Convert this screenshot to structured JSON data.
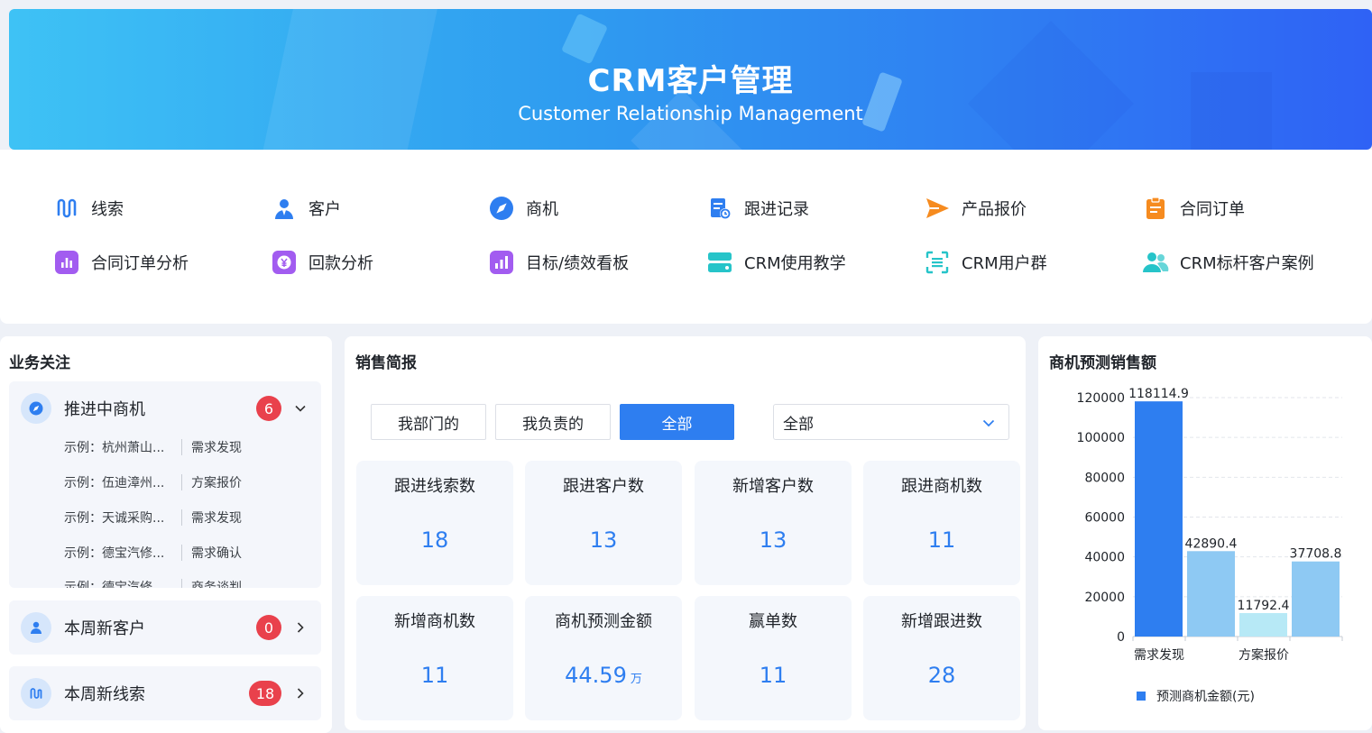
{
  "banner": {
    "title": "CRM客户管理",
    "subtitle": "Customer Relationship Management"
  },
  "quick_nav": [
    {
      "label": "线索",
      "icon": "clue-icon",
      "color": "#2e7ef0"
    },
    {
      "label": "客户",
      "icon": "user-icon",
      "color": "#2e7ef0"
    },
    {
      "label": "商机",
      "icon": "compass-icon",
      "color": "#2e7ef0"
    },
    {
      "label": "跟进记录",
      "icon": "followup-record-icon",
      "color": "#2e7ef0"
    },
    {
      "label": "产品报价",
      "icon": "send-icon",
      "color": "#f68b1f"
    },
    {
      "label": "合同订单",
      "icon": "clipboard-icon",
      "color": "#f68b1f"
    },
    {
      "label": "合同订单分析",
      "icon": "bar-chart-icon",
      "color": "#a25cf0"
    },
    {
      "label": "回款分析",
      "icon": "yen-icon",
      "color": "#a25cf0"
    },
    {
      "label": "目标/绩效看板",
      "icon": "kpi-chart-icon",
      "color": "#a25cf0"
    },
    {
      "label": "CRM使用教学",
      "icon": "stack-icon",
      "color": "#26c4c9"
    },
    {
      "label": "CRM用户群",
      "icon": "scan-icon",
      "color": "#26c4c9"
    },
    {
      "label": "CRM标杆客户案例",
      "icon": "users-icon",
      "color": "#26c4c9"
    }
  ],
  "business": {
    "title": "业务关注",
    "group": {
      "name": "推进中商机",
      "count": "6",
      "rows": [
        {
          "name": "示例：杭州萧山...",
          "stage": "需求发现"
        },
        {
          "name": "示例：伍迪漳州...",
          "stage": "方案报价"
        },
        {
          "name": "示例：天诚采购...",
          "stage": "需求发现"
        },
        {
          "name": "示例：德宝汽修...",
          "stage": "需求确认"
        },
        {
          "name": "示例：德宝汽修",
          "stage": "商务谈判"
        }
      ]
    },
    "new_customers": {
      "name": "本周新客户",
      "count": "0"
    },
    "new_leads": {
      "name": "本周新线索",
      "count": "18"
    }
  },
  "sales": {
    "title": "销售简报",
    "segments": [
      "我部门的",
      "我负责的",
      "全部"
    ],
    "active_segment": "全部",
    "select_value": "全部",
    "stats": [
      {
        "label": "跟进线索数",
        "value": "18",
        "unit": ""
      },
      {
        "label": "跟进客户数",
        "value": "13",
        "unit": ""
      },
      {
        "label": "新增客户数",
        "value": "13",
        "unit": ""
      },
      {
        "label": "跟进商机数",
        "value": "11",
        "unit": ""
      },
      {
        "label": "新增商机数",
        "value": "11",
        "unit": ""
      },
      {
        "label": "商机预测金额",
        "value": "44.59",
        "unit": "万"
      },
      {
        "label": "赢单数",
        "value": "11",
        "unit": ""
      },
      {
        "label": "新增跟进数",
        "value": "28",
        "unit": ""
      }
    ]
  },
  "forecast": {
    "title": "商机预测销售额",
    "legend": "预测商机金额(元)"
  },
  "chart_data": {
    "type": "bar",
    "title": "商机预测销售额",
    "categories": [
      "需求发现",
      "",
      "方案报价",
      ""
    ],
    "visible_tick_labels": [
      "需求发现",
      "方案报价"
    ],
    "series": [
      {
        "name": "预测商机金额(元)",
        "values": [
          118114.9,
          42890.4,
          11792.4,
          37708.8
        ]
      }
    ],
    "bar_colors": [
      "#2e7ef0",
      "#8ec9f3",
      "#b7e9f6",
      "#8ec9f3"
    ],
    "data_labels": [
      "118114.9",
      "42890.4",
      "11792.4",
      "37708.8"
    ],
    "ylim": [
      0,
      120000
    ],
    "yticks": [
      0,
      20000,
      40000,
      60000,
      80000,
      100000,
      120000
    ],
    "grid": true,
    "legend_position": "bottom"
  }
}
